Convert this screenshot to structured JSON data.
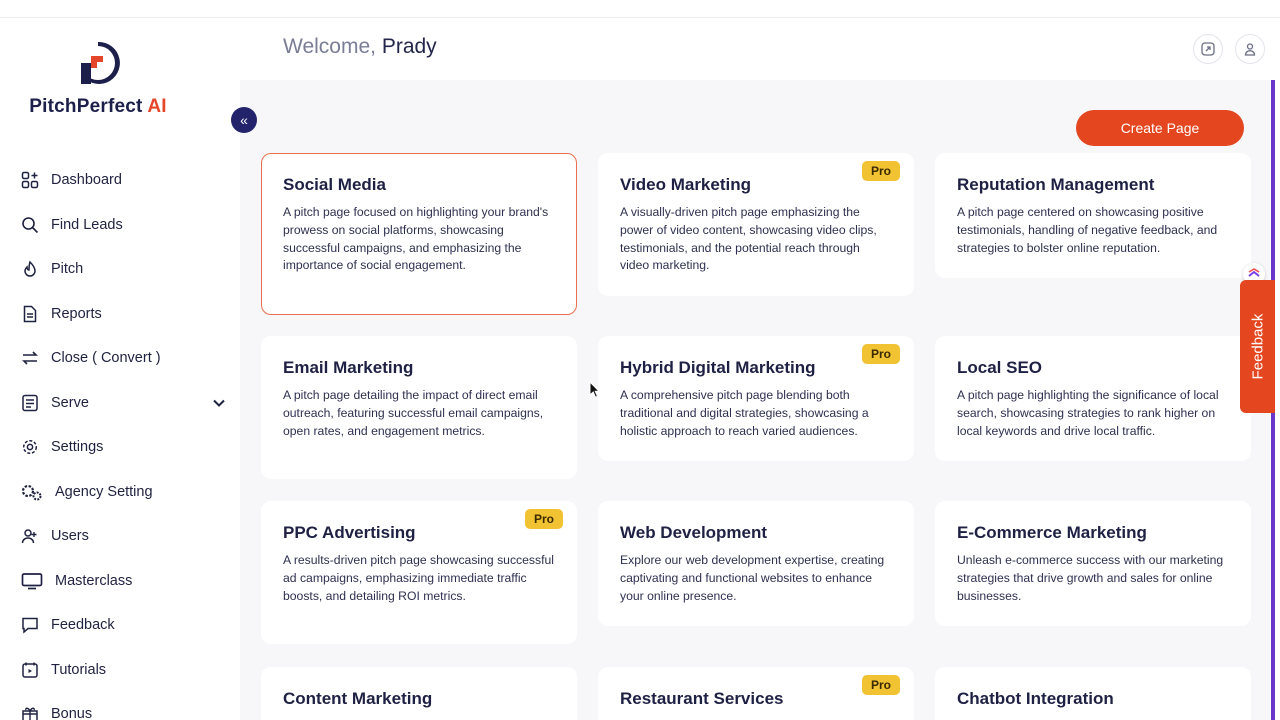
{
  "brand": {
    "name": "PitchPerfect",
    "suffix": "AI"
  },
  "header": {
    "welcome": "Welcome,",
    "user": "Prady"
  },
  "sidebar": {
    "items": [
      {
        "label": "Dashboard",
        "icon": "dashboard-icon"
      },
      {
        "label": "Find Leads",
        "icon": "search-icon"
      },
      {
        "label": "Pitch",
        "icon": "pitch-icon"
      },
      {
        "label": "Reports",
        "icon": "report-icon"
      },
      {
        "label": "Close ( Convert )",
        "icon": "convert-icon"
      },
      {
        "label": "Serve",
        "icon": "serve-icon"
      },
      {
        "label": "Settings",
        "icon": "gear-icon"
      },
      {
        "label": "Agency Setting",
        "icon": "agency-gear-icon"
      },
      {
        "label": "Users",
        "icon": "users-icon"
      },
      {
        "label": "Masterclass",
        "icon": "monitor-icon"
      },
      {
        "label": "Feedback",
        "icon": "chat-icon"
      },
      {
        "label": "Tutorials",
        "icon": "tutorial-icon"
      },
      {
        "label": "Bonus",
        "icon": "gift-icon"
      }
    ]
  },
  "actions": {
    "create_page": "Create Page"
  },
  "cards": [
    {
      "title": "Social Media",
      "desc": "A pitch page focused on highlighting your brand's prowess on social platforms, showcasing successful campaigns, and emphasizing the importance of social engagement.",
      "pro": ""
    },
    {
      "title": "Video Marketing",
      "desc": "A visually-driven pitch page emphasizing the power of video content, showcasing video clips, testimonials, and the potential reach through video marketing.",
      "pro": "Pro"
    },
    {
      "title": "Reputation Management",
      "desc": "A pitch page centered on showcasing positive testimonials, handling of negative feedback, and strategies to bolster online reputation.",
      "pro": ""
    },
    {
      "title": "Email Marketing",
      "desc": "A pitch page detailing the impact of direct email outreach, featuring successful email campaigns, open rates, and engagement metrics.",
      "pro": ""
    },
    {
      "title": "Hybrid Digital Marketing",
      "desc": "A comprehensive pitch page blending both traditional and digital strategies, showcasing a holistic approach to reach varied audiences.",
      "pro": "Pro"
    },
    {
      "title": "Local SEO",
      "desc": "A pitch page highlighting the significance of local search, showcasing strategies to rank higher on local keywords and drive local traffic.",
      "pro": ""
    },
    {
      "title": "PPC Advertising",
      "desc": "A results-driven pitch page showcasing successful ad campaigns, emphasizing immediate traffic boosts, and detailing ROI metrics.",
      "pro": "Pro"
    },
    {
      "title": "Web Development",
      "desc": "Explore our web development expertise, creating captivating and functional websites to enhance your online presence.",
      "pro": ""
    },
    {
      "title": "E-Commerce Marketing",
      "desc": "Unleash e-commerce success with our marketing strategies that drive growth and sales for online businesses.",
      "pro": ""
    },
    {
      "title": "Content Marketing",
      "desc": "",
      "pro": ""
    },
    {
      "title": "Restaurant Services",
      "desc": "",
      "pro": "Pro"
    },
    {
      "title": "Chatbot Integration",
      "desc": "",
      "pro": ""
    }
  ],
  "feedback_tab": {
    "label": "Feedback"
  },
  "colors": {
    "accent": "#e4461f",
    "brand_dark": "#1c1f4a",
    "pro_badge": "#f1c232",
    "scroll_accent": "#6c35c9"
  }
}
